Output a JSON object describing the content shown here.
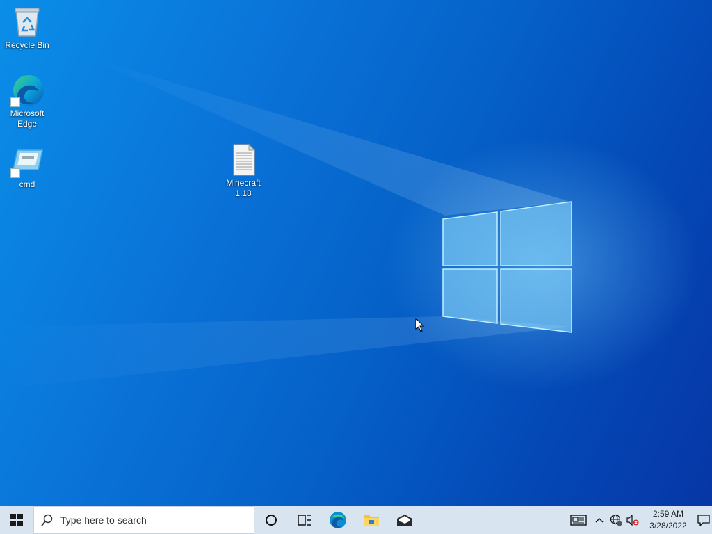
{
  "desktop": {
    "icons": [
      {
        "label": "Recycle Bin"
      },
      {
        "label": "Microsoft Edge"
      },
      {
        "label": "cmd"
      },
      {
        "label": "Minecraft 1.18"
      }
    ]
  },
  "taskbar": {
    "search_placeholder": "Type here to search",
    "pinned": [
      "Microsoft Edge",
      "File Explorer",
      "Mail"
    ],
    "clock": {
      "time": "2:59 AM",
      "date": "3/28/2022"
    }
  },
  "colors": {
    "desktop_primary": "#0a74d9",
    "taskbar_bg": "#d8e4f0",
    "start_button": "#1a1a1a"
  }
}
